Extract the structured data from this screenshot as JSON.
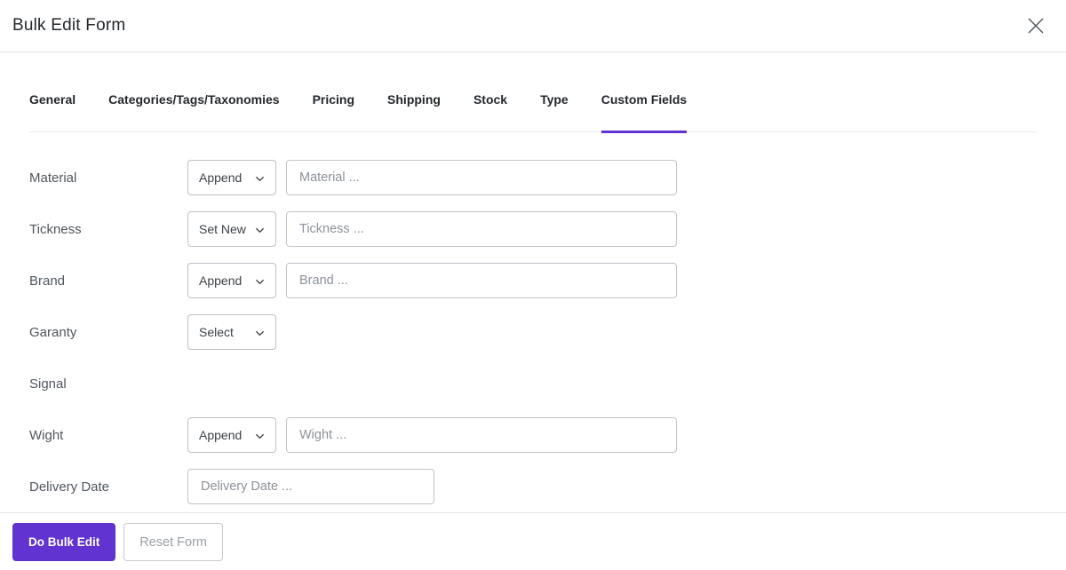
{
  "header": {
    "title": "Bulk Edit Form"
  },
  "tabs": [
    {
      "label": "General",
      "active": false
    },
    {
      "label": "Categories/Tags/Taxonomies",
      "active": false
    },
    {
      "label": "Pricing",
      "active": false
    },
    {
      "label": "Shipping",
      "active": false
    },
    {
      "label": "Stock",
      "active": false
    },
    {
      "label": "Type",
      "active": false
    },
    {
      "label": "Custom Fields",
      "active": true
    }
  ],
  "fields": [
    {
      "label": "Material",
      "mode": "Append",
      "placeholder": "Material ..."
    },
    {
      "label": "Tickness",
      "mode": "Set New",
      "placeholder": "Tickness ..."
    },
    {
      "label": "Brand",
      "mode": "Append",
      "placeholder": "Brand ..."
    },
    {
      "label": "Garanty",
      "mode": "Select"
    },
    {
      "label": "Signal"
    },
    {
      "label": "Wight",
      "mode": "Append",
      "placeholder": "Wight ..."
    },
    {
      "label": "Delivery Date",
      "placeholder": "Delivery Date ..."
    }
  ],
  "footer": {
    "submit_label": "Do Bulk Edit",
    "reset_label": "Reset Form"
  },
  "colors": {
    "accent": "#6133d0",
    "active_tab_underline": "#5b2fd6",
    "border": "#b9bfc6",
    "divider": "#e4e6e9",
    "placeholder_text": "#8c929a"
  }
}
